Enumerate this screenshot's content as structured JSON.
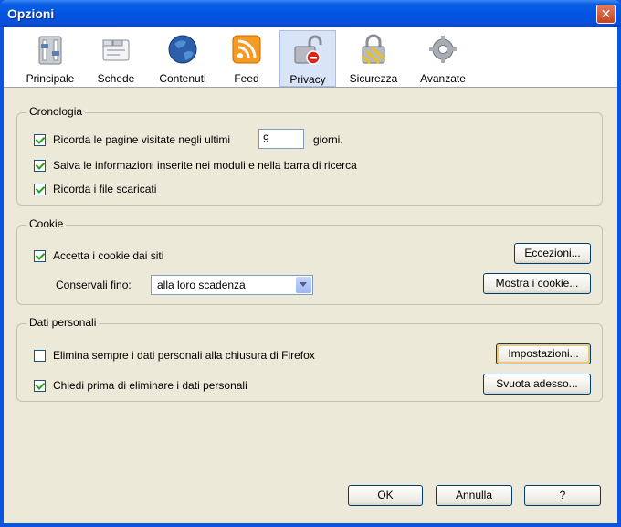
{
  "window": {
    "title": "Opzioni",
    "close_glyph": "✕"
  },
  "tabs": [
    {
      "label": "Principale",
      "icon": "switches-icon"
    },
    {
      "label": "Schede",
      "icon": "tabs-icon"
    },
    {
      "label": "Contenuti",
      "icon": "globe-icon"
    },
    {
      "label": "Feed",
      "icon": "rss-icon"
    },
    {
      "label": "Privacy",
      "icon": "lock-open-icon",
      "selected": true
    },
    {
      "label": "Sicurezza",
      "icon": "padlock-icon"
    },
    {
      "label": "Avanzate",
      "icon": "gear-icon"
    }
  ],
  "history": {
    "title": "Cronologia",
    "remember_visited_label": "Ricorda le pagine visitate negli ultimi",
    "days_value": "9",
    "days_unit": "giorni.",
    "save_form_label": "Salva le informazioni inserite nei moduli e nella barra di ricerca",
    "remember_downloads_label": "Ricorda i file scaricati"
  },
  "cookies": {
    "title": "Cookie",
    "accept_label": "Accetta i cookie dai siti",
    "keep_until_label": "Conservali fino:",
    "keep_until_value": "alla loro scadenza",
    "exceptions_button": "Eccezioni...",
    "show_cookies_button": "Mostra i cookie..."
  },
  "private_data": {
    "title": "Dati personali",
    "always_clear_label": "Elimina sempre i dati personali alla chiusura di Firefox",
    "ask_before_label": "Chiedi prima di eliminare i dati personali",
    "settings_button": "Impostazioni...",
    "clear_now_button": "Svuota adesso..."
  },
  "footer": {
    "ok_button": "OK",
    "cancel_button": "Annulla",
    "help_button": "?"
  },
  "colors": {
    "title_bar": "#0054e3",
    "dialog_bg": "#ece9d8",
    "check_green": "#21a121"
  }
}
